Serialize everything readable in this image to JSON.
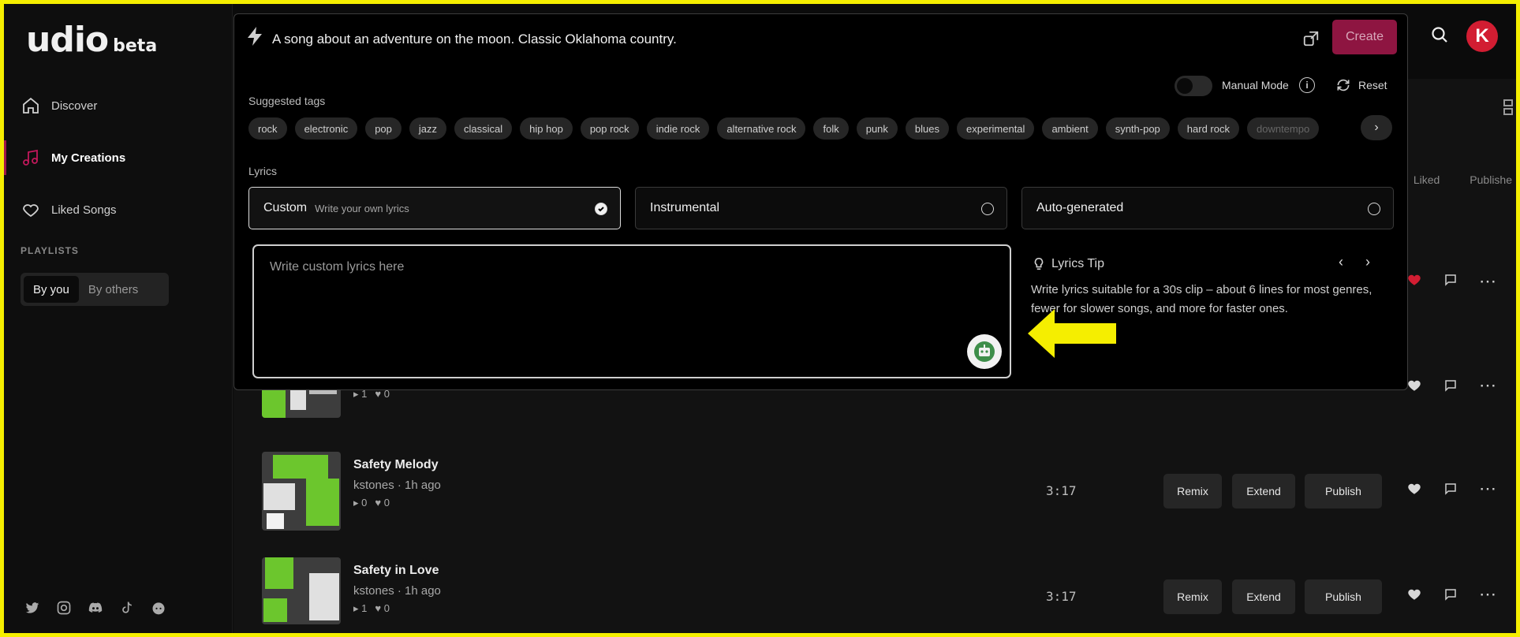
{
  "sidebar": {
    "logo": "udio",
    "logo_suffix": "beta",
    "nav": [
      {
        "label": "Discover",
        "icon": "home-icon"
      },
      {
        "label": "My Creations",
        "icon": "music-note-icon"
      },
      {
        "label": "Liked Songs",
        "icon": "heart-icon"
      }
    ],
    "playlists_heading": "PLAYLISTS",
    "playlist_tabs": [
      "By you",
      "By others"
    ],
    "socials": [
      "twitter-icon",
      "instagram-icon",
      "discord-icon",
      "tiktok-icon",
      "reddit-icon"
    ]
  },
  "header": {
    "avatar_letter": "K",
    "accent_color": "#a0174a"
  },
  "create": {
    "prompt": "A song about an adventure on the moon. Classic Oklahoma country.",
    "create_label": "Create",
    "manual_mode_label": "Manual Mode",
    "reset_label": "Reset",
    "suggested_tags_label": "Suggested tags",
    "tags": [
      "rock",
      "electronic",
      "pop",
      "jazz",
      "classical",
      "hip hop",
      "pop rock",
      "indie rock",
      "alternative rock",
      "folk",
      "punk",
      "blues",
      "experimental",
      "ambient",
      "synth-pop",
      "hard rock",
      "downtempo"
    ],
    "lyrics_label": "Lyrics",
    "lyrics_options": [
      {
        "name": "Custom",
        "sub": "Write your own lyrics",
        "selected": true
      },
      {
        "name": "Instrumental",
        "sub": "",
        "selected": false
      },
      {
        "name": "Auto-generated",
        "sub": "",
        "selected": false
      }
    ],
    "lyrics_placeholder": "Write custom lyrics here",
    "tip_title": "Lyrics Tip",
    "tip_text": "Write lyrics suitable for a 30s clip – about 6 lines for most genres, fewer for slower songs, and more for faster ones."
  },
  "list": {
    "filters": [
      "Liked",
      "Publishe"
    ],
    "rows": [
      {
        "title": "",
        "meta": "",
        "plays": "1",
        "likes": "0",
        "duration": "",
        "liked": false
      },
      {
        "title": "Safety Melody",
        "meta": "kstones · 1h ago",
        "plays": "0",
        "likes": "0",
        "duration": "3:17",
        "liked": false
      },
      {
        "title": "Safety in Love",
        "meta": "kstones · 1h ago",
        "plays": "1",
        "likes": "0",
        "duration": "3:17",
        "liked": false
      }
    ],
    "buttons": {
      "remix": "Remix",
      "extend": "Extend",
      "publish": "Publish"
    }
  }
}
